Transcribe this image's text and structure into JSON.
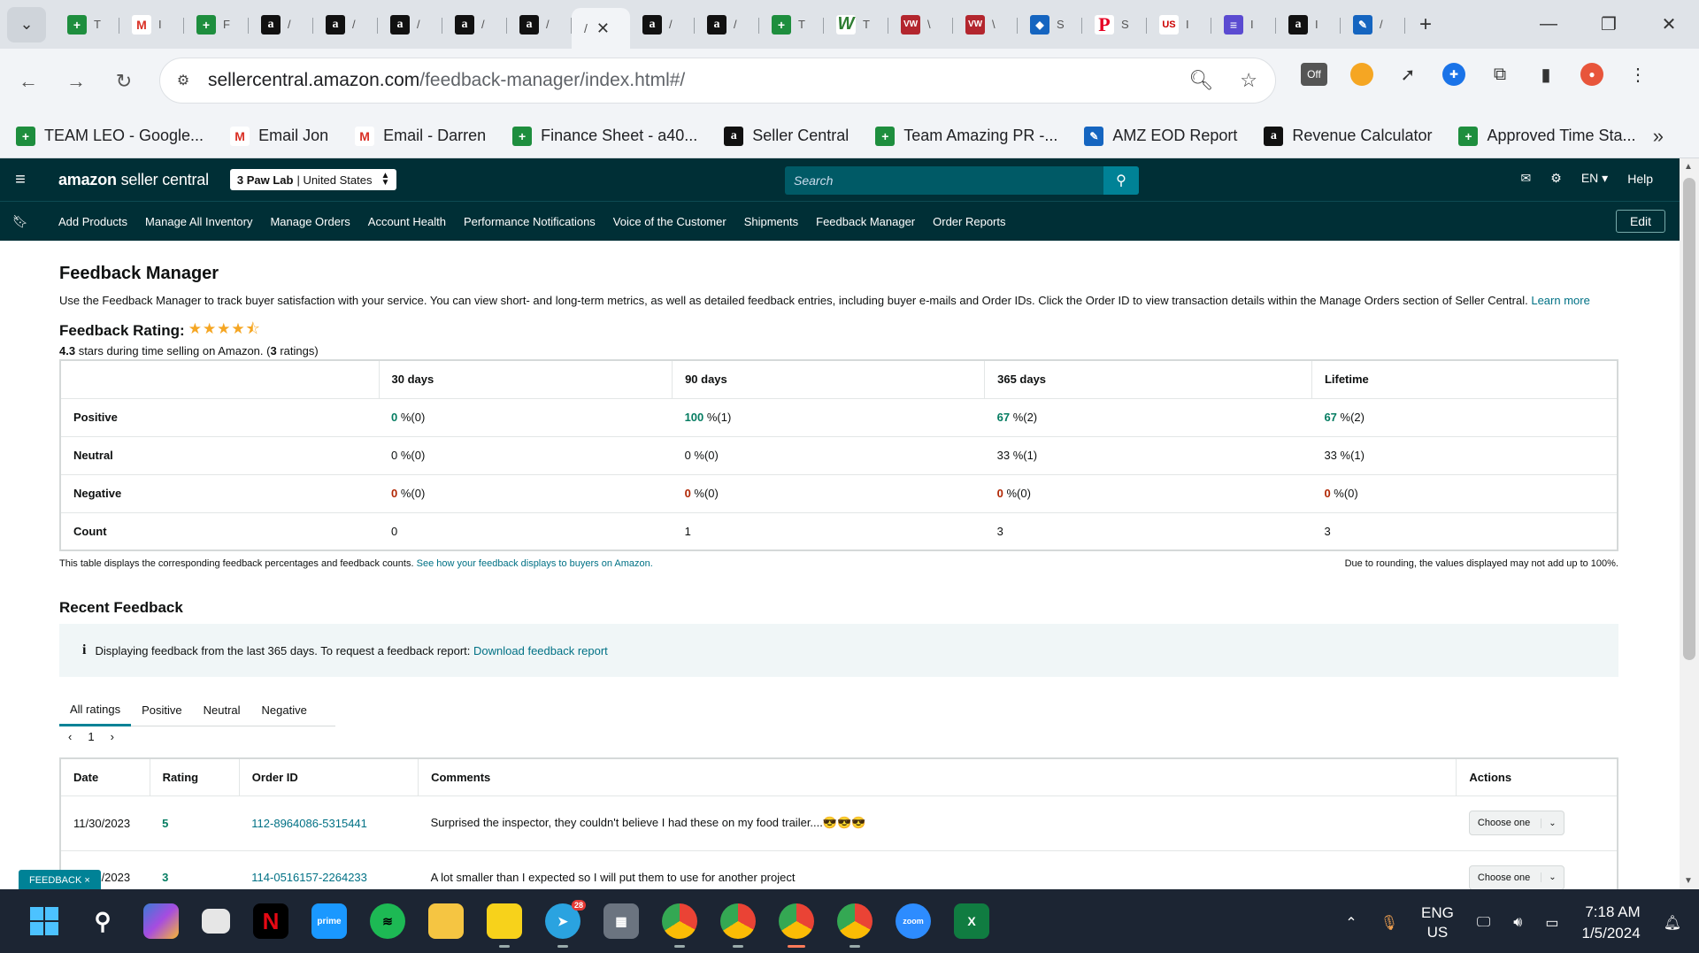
{
  "browser": {
    "tabs": [
      {
        "icon": "sheets-icon",
        "glyph": "+",
        "cls": "sheet",
        "title": "T"
      },
      {
        "icon": "gmail-icon",
        "glyph": "M",
        "cls": "gmail",
        "title": "I"
      },
      {
        "icon": "sheets-icon",
        "glyph": "+",
        "cls": "sheet",
        "title": "F"
      },
      {
        "icon": "amazon-icon",
        "glyph": "a",
        "cls": "amz",
        "title": "/"
      },
      {
        "icon": "amazon-icon",
        "glyph": "a",
        "cls": "amz",
        "title": "/"
      },
      {
        "icon": "amazon-icon",
        "glyph": "a",
        "cls": "amz",
        "title": "/"
      },
      {
        "icon": "amazon-icon",
        "glyph": "a",
        "cls": "amz",
        "title": "/"
      },
      {
        "icon": "amazon-icon",
        "glyph": "a",
        "cls": "amz",
        "title": "/"
      }
    ],
    "active_tab_title": "/",
    "tabs_after": [
      {
        "icon": "amazon-icon",
        "glyph": "a",
        "cls": "amz",
        "title": "/"
      },
      {
        "icon": "amazon-icon",
        "glyph": "a",
        "cls": "amz",
        "title": "/"
      },
      {
        "icon": "sheets-icon",
        "glyph": "+",
        "cls": "sheet",
        "title": "T"
      },
      {
        "icon": "w-icon",
        "glyph": "W",
        "cls": "w",
        "title": "T"
      },
      {
        "icon": "vw-icon",
        "glyph": "VW",
        "cls": "vw",
        "title": "\\"
      },
      {
        "icon": "vw-icon",
        "glyph": "VW",
        "cls": "vw",
        "title": "\\"
      },
      {
        "icon": "diamond-icon",
        "glyph": "◆",
        "cls": "blue",
        "title": "S"
      },
      {
        "icon": "pinterest-icon",
        "glyph": "P",
        "cls": "pin",
        "title": "S"
      },
      {
        "icon": "usfoods-icon",
        "glyph": "US",
        "cls": "us",
        "title": "I"
      },
      {
        "icon": "list-icon",
        "glyph": "≡",
        "cls": "list",
        "title": "I"
      },
      {
        "icon": "amazon-icon",
        "glyph": "a",
        "cls": "amz",
        "title": "I"
      },
      {
        "icon": "pen-icon",
        "glyph": "✎",
        "cls": "blue",
        "title": "/"
      }
    ],
    "url_host": "sellercentral.amazon.com",
    "url_path": "/feedback-manager/index.html#/",
    "extension_badge": "Off",
    "bookmarks": [
      {
        "icon": "sheets-icon",
        "glyph": "+",
        "cls": "sheet",
        "label": "TEAM LEO - Google..."
      },
      {
        "icon": "gmail-icon",
        "glyph": "M",
        "cls": "gmail",
        "label": "Email Jon"
      },
      {
        "icon": "gmail-icon",
        "glyph": "M",
        "cls": "gmail",
        "label": "Email - Darren"
      },
      {
        "icon": "sheets-icon",
        "glyph": "+",
        "cls": "sheet",
        "label": "Finance Sheet - a40..."
      },
      {
        "icon": "amazon-icon",
        "glyph": "a",
        "cls": "amz",
        "label": "Seller Central"
      },
      {
        "icon": "sheets-icon",
        "glyph": "+",
        "cls": "sheet",
        "label": "Team Amazing PR -..."
      },
      {
        "icon": "pen-icon",
        "glyph": "✎",
        "cls": "blue",
        "label": "AMZ EOD Report"
      },
      {
        "icon": "amazon-icon",
        "glyph": "a",
        "cls": "amz",
        "label": "Revenue Calculator"
      },
      {
        "icon": "sheets-icon",
        "glyph": "+",
        "cls": "sheet",
        "label": "Approved Time Sta..."
      }
    ]
  },
  "header": {
    "logo_bold": "amazon",
    "logo_rest": " seller central",
    "store_name": "3 Paw Lab",
    "store_region": "| United States",
    "search_placeholder": "Search",
    "language": "EN",
    "help": "Help"
  },
  "nav": {
    "items": [
      "Add Products",
      "Manage All Inventory",
      "Manage Orders",
      "Account Health",
      "Performance Notifications",
      "Voice of the Customer",
      "Shipments",
      "Feedback Manager",
      "Order Reports"
    ],
    "edit": "Edit"
  },
  "page": {
    "title": "Feedback Manager",
    "description": "Use the Feedback Manager to track buyer satisfaction with your service. You can view short- and long-term metrics, as well as detailed feedback entries, including buyer e-mails and Order IDs. Click the Order ID to view transaction details within the Manage Orders section of Seller Central.",
    "learn_more": "Learn more",
    "rating_label": "Feedback Rating:",
    "stars": "★★★★⯪",
    "rating_value": "4.3",
    "rating_text_mid": " stars during time selling on Amazon. (",
    "rating_count": "3",
    "rating_text_end": " ratings)"
  },
  "metrics": {
    "columns": [
      "30 days",
      "90 days",
      "365 days",
      "Lifetime"
    ],
    "rows": [
      {
        "label": "Positive",
        "cells": [
          [
            "0",
            " %(0)"
          ],
          [
            "100",
            " %(1)"
          ],
          [
            "67",
            " %(2)"
          ],
          [
            "67",
            " %(2)"
          ]
        ],
        "cls": "pos"
      },
      {
        "label": "Neutral",
        "cells": [
          [
            "0",
            " %(0)"
          ],
          [
            "0",
            " %(0)"
          ],
          [
            "33",
            " %(1)"
          ],
          [
            "33",
            " %(1)"
          ]
        ],
        "cls": ""
      },
      {
        "label": "Negative",
        "cells": [
          [
            "0",
            " %(0)"
          ],
          [
            "0",
            " %(0)"
          ],
          [
            "0",
            " %(0)"
          ],
          [
            "0",
            " %(0)"
          ]
        ],
        "cls": "neg"
      },
      {
        "label": "Count",
        "cells": [
          [
            "0",
            ""
          ],
          [
            "1",
            ""
          ],
          [
            "3",
            ""
          ],
          [
            "3",
            ""
          ]
        ],
        "cls": ""
      }
    ],
    "note_left": "This table displays the corresponding feedback percentages and feedback counts.",
    "note_link": "See how your feedback displays to buyers on Amazon.",
    "note_right": "Due to rounding, the values displayed may not add up to 100%."
  },
  "recent": {
    "title": "Recent Feedback",
    "info_text": "Displaying feedback from the last 365 days. To request a feedback report:",
    "info_link": "Download feedback report",
    "filters": [
      "All ratings",
      "Positive",
      "Neutral",
      "Negative"
    ],
    "page": "1",
    "columns": [
      "Date",
      "Rating",
      "Order ID",
      "Comments",
      "Actions"
    ],
    "rows": [
      {
        "date": "11/30/2023",
        "rating": "5",
        "order_id": "112-8964086-5315441",
        "comment": "Surprised the inspector, they couldn't believe I had these on my food trailer....😎😎😎",
        "action": "Choose one"
      },
      {
        "date": "11/27/2023",
        "rating": "3",
        "order_id": "114-0516157-2264233",
        "comment": "A lot smaller than I expected so I will put them to use for another project",
        "action": "Choose one"
      }
    ],
    "feedback_pill": "FEEDBACK ×"
  },
  "taskbar": {
    "telegram_badge": "28",
    "lang1": "ENG",
    "lang2": "US",
    "time": "7:18 AM",
    "date": "1/5/2024"
  }
}
